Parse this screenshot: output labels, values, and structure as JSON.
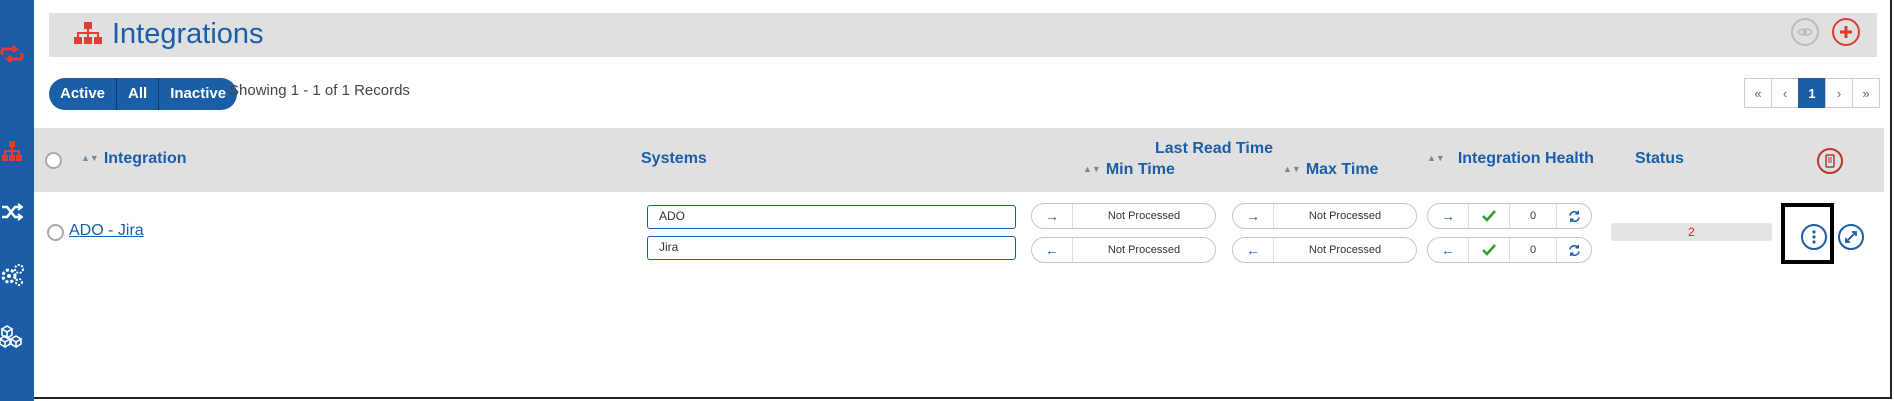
{
  "sidebar": {
    "icons": [
      "sync-icon",
      "integrations-icon",
      "shuffle-icon",
      "settings-icon",
      "cubes-icon"
    ]
  },
  "header": {
    "title": "Integrations",
    "icons": [
      "eye-icon",
      "add-icon"
    ]
  },
  "filters": {
    "active": "Active",
    "all": "All",
    "inactive": "Inactive"
  },
  "records_text": "Showing 1 - 1 of 1 Records",
  "pagination": {
    "first": "«",
    "prev": "‹",
    "current": "1",
    "next": "›",
    "last": "»"
  },
  "table": {
    "headers": {
      "integration": "Integration",
      "systems": "Systems",
      "last_read_time": "Last Read Time",
      "min_time": "Min Time",
      "max_time": "Max Time",
      "integration_health": "Integration Health",
      "status": "Status"
    },
    "rows": [
      {
        "name": "ADO - Jira",
        "systems": [
          "ADO",
          "Jira"
        ],
        "min_time": [
          "Not Processed",
          "Not Processed"
        ],
        "max_time": [
          "Not Processed",
          "Not Processed"
        ],
        "health": [
          {
            "direction": "→",
            "count": "0"
          },
          {
            "direction": "←",
            "count": "0"
          }
        ],
        "status": "2"
      }
    ]
  },
  "arrows": {
    "right": "→",
    "left": "←"
  },
  "colors": {
    "brand_blue": "#1a5ea8",
    "accent_red": "#e03c31",
    "sidebar": "#1a5da6",
    "check_green": "#2e9d2e"
  }
}
